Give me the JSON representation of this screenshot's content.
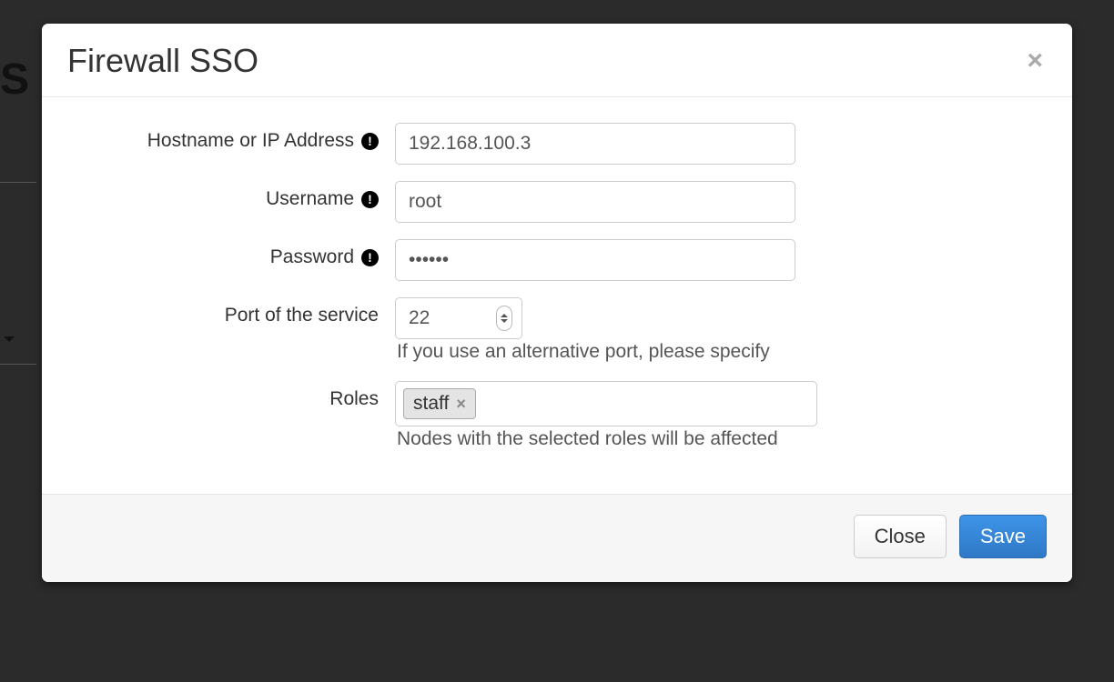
{
  "modal": {
    "title": "Firewall SSO",
    "fields": {
      "hostname": {
        "label": "Hostname or IP Address",
        "value": "192.168.100.3"
      },
      "username": {
        "label": "Username",
        "value": "root"
      },
      "password": {
        "label": "Password",
        "value": "••••••"
      },
      "port": {
        "label": "Port of the service",
        "value": "22",
        "help": "If you use an alternative port, please specify"
      },
      "roles": {
        "label": "Roles",
        "tag": "staff",
        "help": "Nodes with the selected roles will be affected"
      }
    },
    "buttons": {
      "close": "Close",
      "save": "Save"
    }
  },
  "background": {
    "partial_heading": "S"
  }
}
